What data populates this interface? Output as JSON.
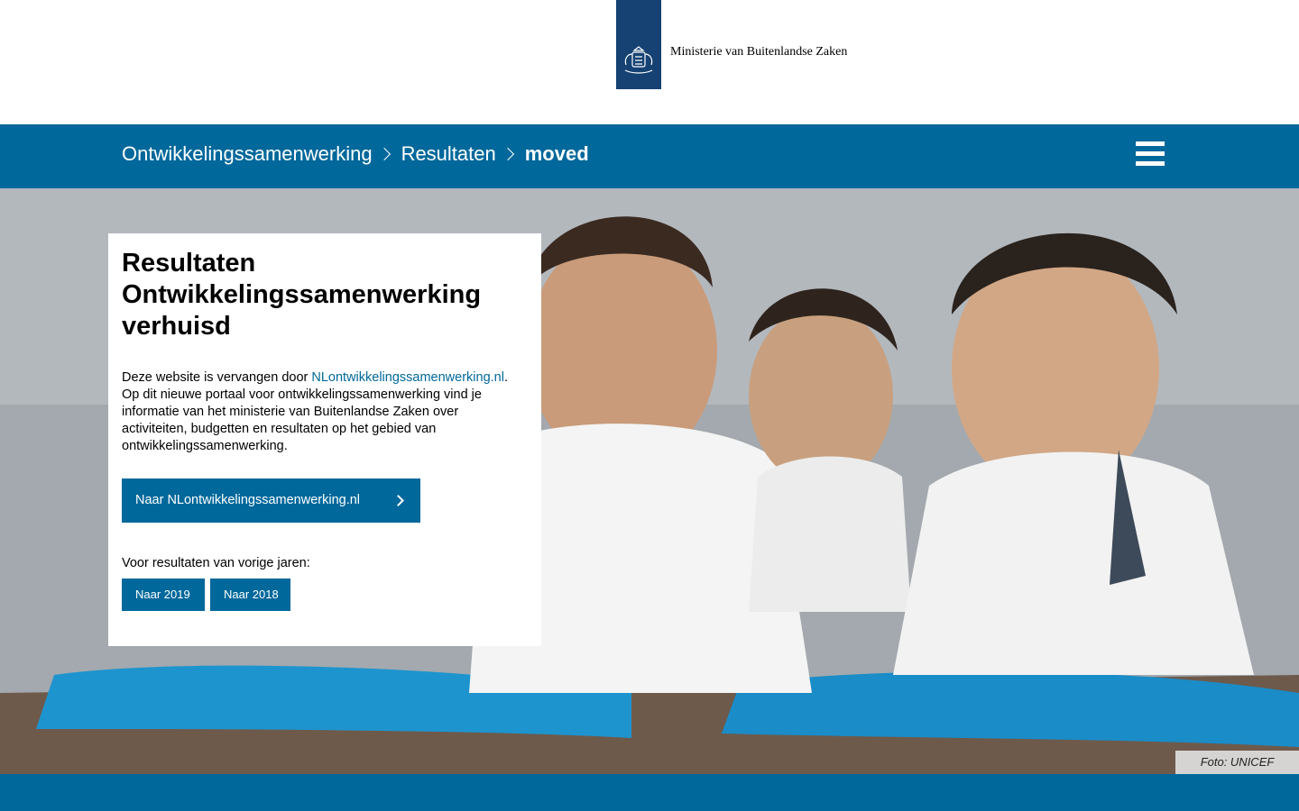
{
  "header": {
    "logo_text": "Ministerie van Buitenlandse Zaken",
    "logo_color": "#154273"
  },
  "nav": {
    "breadcrumb": [
      {
        "label": "Ontwikkelingssamenwerking"
      },
      {
        "label": "Resultaten"
      },
      {
        "label": "moved"
      }
    ],
    "bar_color": "#01689b",
    "menu_icon": "hamburger-menu-icon"
  },
  "card": {
    "title": "Resultaten Ontwikkelingssamenwerking verhuisd",
    "intro_prefix": "Deze website is vervangen door ",
    "intro_link": "NLontwikkelingssamenwerking.nl",
    "intro_suffix": ". Op dit nieuwe portaal voor ontwikkelingssamenwerking vind je informatie van het ministerie van Buitenlandse Zaken over activiteiten, budgetten en resultaten op het gebied van ontwikkelingssamenwerking.",
    "cta_label": "Naar NLontwikkelingssamenwerking.nl",
    "previous_label": "Voor resultaten van vorige jaren:",
    "year_buttons": [
      {
        "label": "Naar 2019"
      },
      {
        "label": "Naar 2018"
      }
    ]
  },
  "hero": {
    "photo_credit": "Foto: UNICEF"
  }
}
